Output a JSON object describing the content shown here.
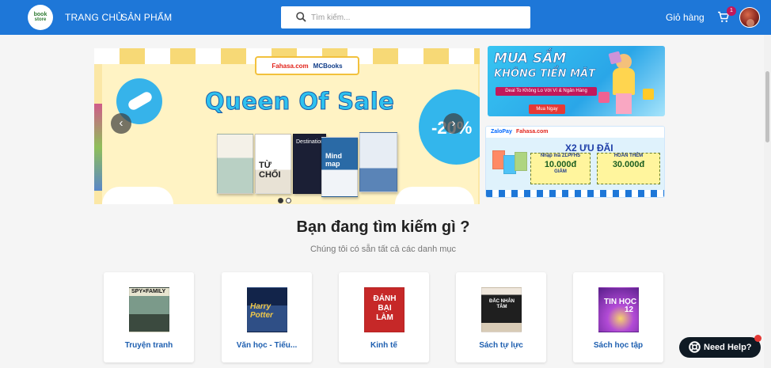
{
  "header": {
    "logo_line1": "book",
    "logo_line2": "store",
    "nav_home": "TRANG CHỦ",
    "nav_products": "SẢN PHẨM",
    "search_placeholder": "Tìm kiếm...",
    "cart_label": "Giỏ hàng",
    "cart_count": "1",
    "colors": {
      "bar": "#1e77d8",
      "badge": "#c2185b"
    }
  },
  "carousel": {
    "brand_left": "Fahasa.com",
    "brand_right": "MCBooks",
    "title": "Queen Of Sale",
    "discount": "-20%",
    "book_titles": [
      "TỪ CHỐI",
      "Destination",
      "Mind map"
    ],
    "prev_icon": "chevron-left-icon",
    "next_icon": "chevron-right-icon",
    "active_slide": 1,
    "slide_count": 2
  },
  "promo_cashless": {
    "title_line1": "MUA SẮM",
    "title_line2": "KHÔNG TIỀN MẶT",
    "subtitle": "Deal To Không Lo Với Ví & Ngân Hàng",
    "button": "Mua Ngay"
  },
  "promo_zalopay": {
    "brand_left": "ZaloPay",
    "brand_right": "Fahasa.com",
    "headline": "X2 ƯU ĐÃI",
    "code_label": "Nhập mã ZLPFHS",
    "voucher1_label": "GIẢM",
    "voucher1_value": "10.000đ",
    "voucher2_label": "HOÀN THÊM",
    "voucher2_value": "30.000đ"
  },
  "section": {
    "heading": "Bạn đang tìm kiếm gì ?",
    "subheading": "Chúng tôi có sẵn tất cả các danh mục"
  },
  "categories": [
    {
      "label": "Truyện tranh",
      "cover_text": "SPY×FAMILY"
    },
    {
      "label": "Văn học - Tiểu...",
      "cover_text": "Harry Potter"
    },
    {
      "label": "Kinh tế",
      "cover_text": "ĐÁNH BẠI LÀM"
    },
    {
      "label": "Sách tự lực",
      "cover_text": "ĐẮC NHÂN TÂM"
    },
    {
      "label": "Sách học tập",
      "cover_text": "TIN HỌC",
      "cover_number": "12"
    }
  ],
  "help": {
    "label": "Need Help?",
    "icon": "lifebuoy-icon"
  }
}
